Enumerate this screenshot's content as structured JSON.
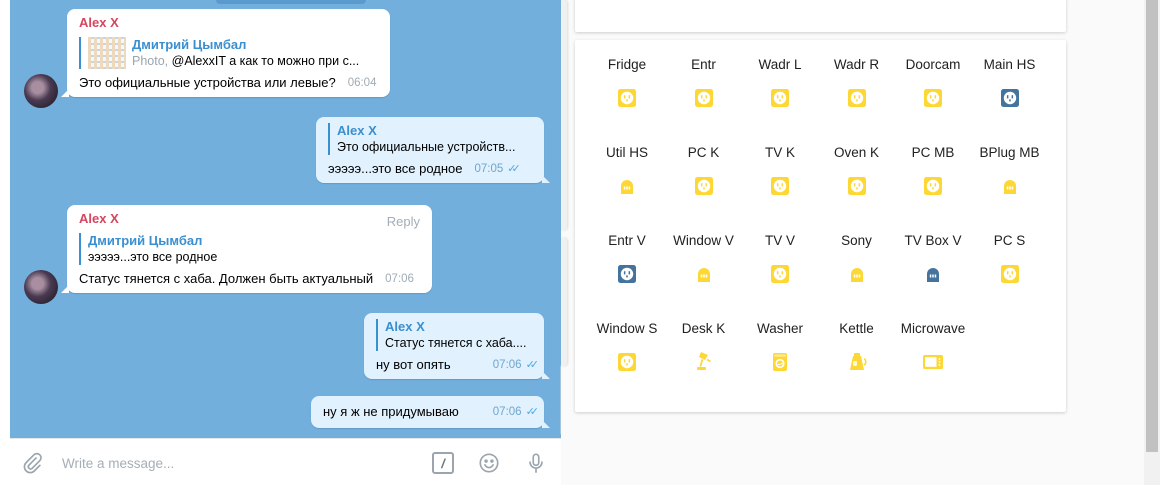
{
  "telegram": {
    "messages": [
      {
        "sender": "Alex X",
        "quote_name": "Дмитрий Цымбал",
        "quote_media": "Photo, ",
        "quote_text": "@AlexxIT а как то можно при с...",
        "text": "Это официальные устройства или левые?",
        "time": "06:04"
      },
      {
        "quote_name": "Alex X",
        "quote_text": "Это официальные устройств...",
        "text": "эээээ...это все родное",
        "time": "07:05",
        "ticks": "✓✓"
      },
      {
        "sender": "Alex X",
        "reply_label": "Reply",
        "quote_name": "Дмитрий Цымбал",
        "quote_text": "эээээ...это все родное",
        "text": "Статус тянется с хаба. Должен быть актуальный",
        "time": "07:06"
      },
      {
        "quote_name": "Alex X",
        "quote_text": "Статус тянется с хаба....",
        "text": "ну вот опять",
        "time": "07:06",
        "ticks": "✓✓"
      },
      {
        "text": "ну я ж не придумываю",
        "time": "07:06",
        "ticks": "✓✓"
      }
    ],
    "composer": {
      "placeholder": "Write a message...",
      "attach_icon": "paperclip-icon",
      "command_icon": "slash-command-icon",
      "command_glyph": "/",
      "emoji_icon": "emoji-icon",
      "mic_icon": "microphone-icon"
    },
    "colors": {
      "chat_background": "#72afdd",
      "sender_name": "#d5455e",
      "quote_accent": "#3a8fd0",
      "outgoing_bubble": "#e1f1fd",
      "read_ticks": "#4fa8e6"
    }
  },
  "ha": {
    "colors": {
      "on": "#fdd835",
      "off": "#44739e"
    },
    "entities": [
      {
        "name": "Fridge",
        "icon": "power-socket-icon",
        "state": "on"
      },
      {
        "name": "Entr",
        "icon": "power-socket-icon",
        "state": "on"
      },
      {
        "name": "Wadr L",
        "icon": "power-socket-icon",
        "state": "on"
      },
      {
        "name": "Wadr R",
        "icon": "power-socket-icon",
        "state": "on"
      },
      {
        "name": "Doorcam",
        "icon": "power-socket-icon",
        "state": "on"
      },
      {
        "name": "Main HS",
        "icon": "power-socket-icon",
        "state": "off"
      },
      {
        "name": "Util HS",
        "icon": "power-plug-icon",
        "state": "on"
      },
      {
        "name": "PC K",
        "icon": "power-socket-icon",
        "state": "on"
      },
      {
        "name": "TV K",
        "icon": "power-socket-icon",
        "state": "on"
      },
      {
        "name": "Oven K",
        "icon": "power-socket-icon",
        "state": "on"
      },
      {
        "name": "PC MB",
        "icon": "power-socket-icon",
        "state": "on"
      },
      {
        "name": "BPlug MB",
        "icon": "power-plug-icon",
        "state": "on"
      },
      {
        "name": "Entr V",
        "icon": "power-socket-icon",
        "state": "off"
      },
      {
        "name": "Window V",
        "icon": "power-plug-icon",
        "state": "on"
      },
      {
        "name": "TV V",
        "icon": "power-socket-icon",
        "state": "on"
      },
      {
        "name": "Sony",
        "icon": "power-plug-icon",
        "state": "on"
      },
      {
        "name": "TV Box V",
        "icon": "power-plug-icon",
        "state": "off"
      },
      {
        "name": "PC S",
        "icon": "power-socket-icon",
        "state": "on"
      },
      {
        "name": "Window S",
        "icon": "power-socket-icon",
        "state": "on"
      },
      {
        "name": "Desk K",
        "icon": "desk-lamp-icon",
        "state": "on"
      },
      {
        "name": "Washer",
        "icon": "washing-machine-icon",
        "state": "on"
      },
      {
        "name": "Kettle",
        "icon": "kettle-icon",
        "state": "on"
      },
      {
        "name": "Microwave",
        "icon": "microwave-icon",
        "state": "on"
      }
    ]
  }
}
